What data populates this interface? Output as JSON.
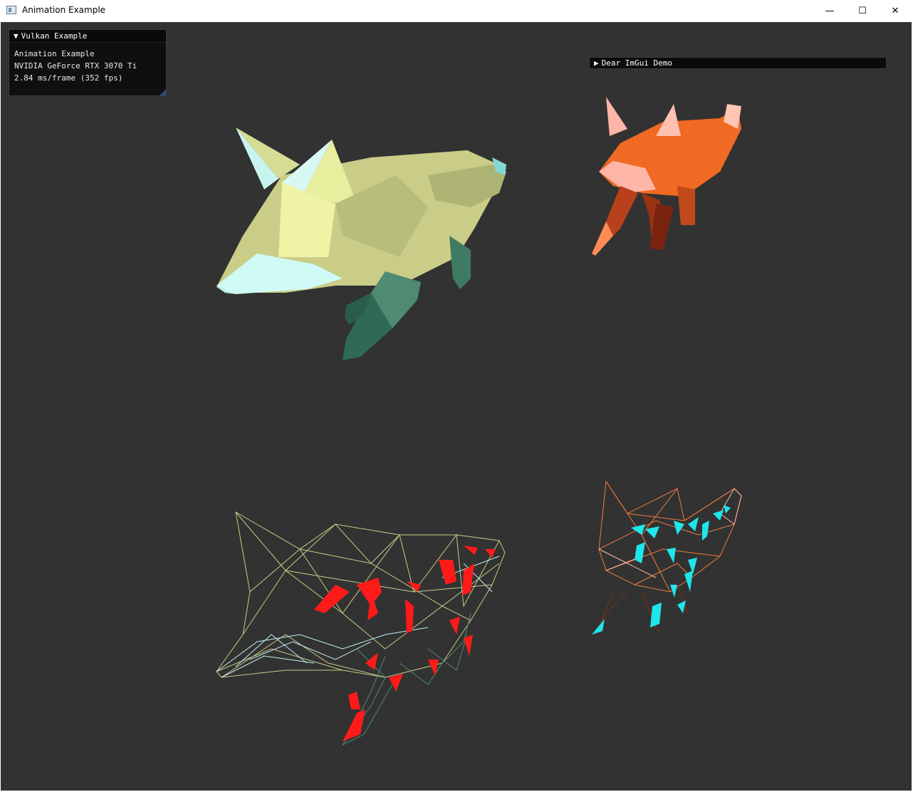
{
  "window": {
    "title": "Animation Example",
    "controls": {
      "minimize": "—",
      "maximize": "☐",
      "close": "✕"
    }
  },
  "imgui_overlay": {
    "header": "Vulkan Example",
    "header_arrow": "▼",
    "lines": [
      "Animation Example",
      "NVIDIA GeForce RTX 3070 Ti",
      "2.84 ms/frame (352 fps)"
    ]
  },
  "demo_window": {
    "arrow": "▶",
    "label": "Dear ImGui Demo"
  },
  "scene": {
    "background": "#323232",
    "models": [
      {
        "name": "fox-solid-green",
        "mode": "solid",
        "colors": [
          "#c9cd88",
          "#e7ee9e",
          "#cffaf6",
          "#3f7a63"
        ]
      },
      {
        "name": "fox-solid-orange",
        "mode": "solid",
        "colors": [
          "#f06a24",
          "#ffb6a8",
          "#b8401a",
          "#7a2410"
        ]
      },
      {
        "name": "fox-wireframe-green",
        "mode": "wireframe",
        "colors": [
          "#c8cc88",
          "#bff3f0",
          "#4f8a74"
        ],
        "joint_color": "#ff1a1a"
      },
      {
        "name": "fox-wireframe-orange",
        "mode": "wireframe",
        "colors": [
          "#f07c3c",
          "#ffb8a8",
          "#7a3010"
        ],
        "joint_color": "#1ee6ea"
      }
    ]
  }
}
